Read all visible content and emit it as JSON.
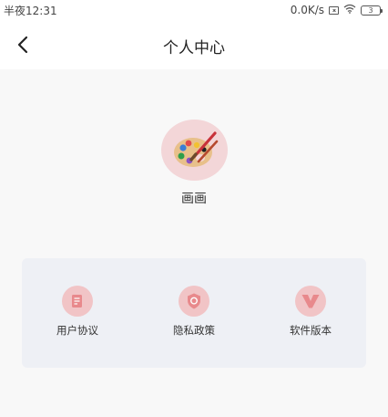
{
  "status_bar": {
    "time": "半夜12:31",
    "network_speed": "0.0K/s",
    "battery_level": "3",
    "icons": [
      "sim-icon",
      "wifi-icon",
      "battery-icon"
    ]
  },
  "header": {
    "back_icon": "chevron-left-icon",
    "title": "个人中心"
  },
  "profile": {
    "avatar_icon": "palette-icon",
    "nickname": "画画"
  },
  "menu": {
    "items": [
      {
        "label": "用户协议",
        "icon": "document-icon"
      },
      {
        "label": "隐私政策",
        "icon": "shield-icon"
      },
      {
        "label": "软件版本",
        "icon": "v-icon"
      }
    ]
  },
  "colors": {
    "accent": "#e8898c",
    "avatar_bg": "#f3d6d8",
    "menu_icon_bg": "#f1c4c6",
    "card_bg": "#eef0f5",
    "page_bg": "#f8f8f8"
  }
}
